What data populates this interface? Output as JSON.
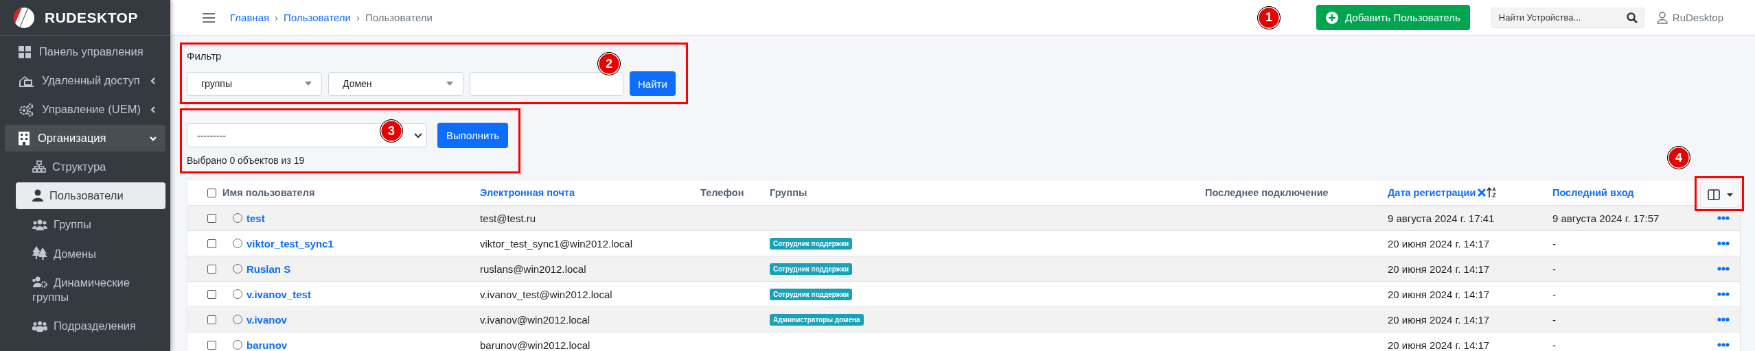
{
  "sidebar": {
    "logo": "RUDESKTOP",
    "items": [
      {
        "label": "Панель управления",
        "selected": false
      },
      {
        "label": "Удаленный доступ",
        "selected": false,
        "expanded": false
      },
      {
        "label": "Управление (UEM)",
        "selected": false,
        "expanded": false
      },
      {
        "label": "Организация",
        "selected": true,
        "expanded": true,
        "children": [
          {
            "label": "Структура",
            "selected": false
          },
          {
            "label": "Пользователи",
            "selected": true
          },
          {
            "label": "Группы",
            "selected": false
          },
          {
            "label": "Домены",
            "selected": false
          },
          {
            "label": "Динамические группы",
            "selected": false
          },
          {
            "label": "Подразделения",
            "selected": false
          }
        ]
      }
    ]
  },
  "breadcrumb": [
    {
      "label": "Главная",
      "link": true
    },
    {
      "separator": "›",
      "label": "Пользователи",
      "link": true
    },
    {
      "separator": "›",
      "label": "Пользователи",
      "link": false
    }
  ],
  "add_button": {
    "label": "Добавить Пользователь",
    "marker": "1"
  },
  "search": {
    "placeholder": "Найти Устройства..."
  },
  "user": {
    "name": "RuDesktop"
  },
  "filter": {
    "title": "Фильтр",
    "marker": "2",
    "selects": [
      {
        "value": "группы"
      },
      {
        "value": "Домен"
      }
    ],
    "button": "Найти"
  },
  "bulk_action": {
    "value": "---------",
    "button": "Выполнить",
    "summary": "Выбрано 0 объектов из 19",
    "marker": "3"
  },
  "table": {
    "column_toggle_marker": "4",
    "select_all": {
      "checked": false
    },
    "columns": [
      {
        "label": "Имя пользователя",
        "link": false,
        "sorted": false
      },
      {
        "label": "Электронная почта",
        "link": true,
        "sorted": false
      },
      {
        "label": "Телефон",
        "link": false,
        "sorted": false
      },
      {
        "label": "Группы",
        "link": false,
        "sorted": false
      },
      {
        "label": "Последнее подключение",
        "link": false,
        "sorted": false
      },
      {
        "label": "Дата регистрации",
        "link": true,
        "sorted": true
      },
      {
        "label": "Последний вход",
        "link": true,
        "sorted": false
      }
    ],
    "rows": [
      {
        "checked": false,
        "selected": false,
        "name": "test",
        "email": "test@test.ru",
        "groups": [],
        "registered": "9 августа 2024 г. 17:41",
        "last_login": "9 августа 2024 г. 17:57"
      },
      {
        "checked": false,
        "selected": false,
        "name": "viktor_test_sync1",
        "email": "viktor_test_sync1@win2012.local",
        "groups": [
          "Сотрудник поддержки"
        ],
        "registered": "20 июня 2024 г. 14:17",
        "last_login": "-"
      },
      {
        "checked": false,
        "selected": false,
        "name": "Ruslan S",
        "email": "ruslans@win2012.local",
        "groups": [
          "Сотрудник поддержки"
        ],
        "registered": "20 июня 2024 г. 14:17",
        "last_login": "-"
      },
      {
        "checked": false,
        "selected": false,
        "name": "v.ivanov_test",
        "email": "v.ivanov_test@win2012.local",
        "groups": [
          "Сотрудник поддержки"
        ],
        "registered": "20 июня 2024 г. 14:17",
        "last_login": "-"
      },
      {
        "checked": false,
        "selected": false,
        "name": "v.ivanov",
        "email": "v.ivanov@win2012.local",
        "groups": [
          "Администраторы домена"
        ],
        "registered": "20 июня 2024 г. 14:17",
        "last_login": "-"
      },
      {
        "checked": false,
        "selected": false,
        "name": "barunov",
        "email": "barunov@win2012.local",
        "groups": [],
        "registered": "20 июня 2024 г. 14:17",
        "last_login": "-"
      }
    ]
  }
}
